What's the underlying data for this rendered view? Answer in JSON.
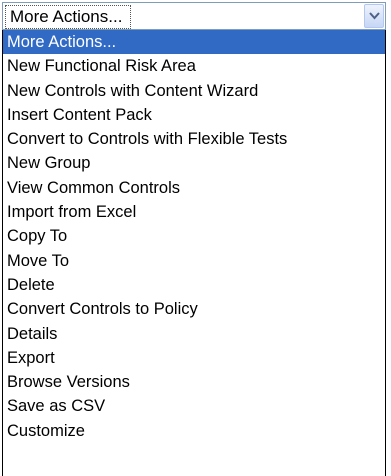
{
  "select": {
    "value": "More Actions...",
    "icon": "chevron-down-icon"
  },
  "options": [
    "More Actions...",
    "New Functional Risk Area",
    "New Controls with Content Wizard",
    "Insert Content Pack",
    "Convert to Controls with Flexible Tests",
    "New Group",
    "View Common Controls",
    "Import from Excel",
    "Copy To",
    "Move To",
    "Delete",
    "Convert Controls to Policy",
    "Details",
    "Export",
    "Browse Versions",
    "Save as CSV",
    "Customize"
  ],
  "selected_index": 0,
  "colors": {
    "highlight": "#316ac5",
    "border": "#7f9db9"
  }
}
